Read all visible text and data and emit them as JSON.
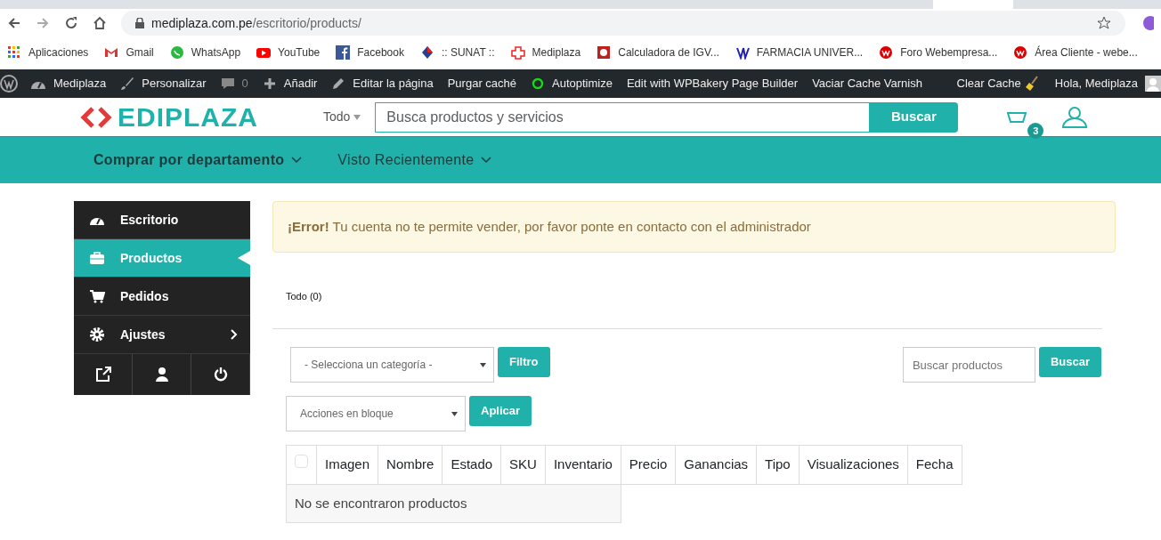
{
  "browser": {
    "address": {
      "domain": "mediplaza.com.pe",
      "path": "/escritorio/products/"
    },
    "bookmarks": [
      {
        "label": "Aplicaciones"
      },
      {
        "label": "Gmail"
      },
      {
        "label": "WhatsApp"
      },
      {
        "label": "YouTube"
      },
      {
        "label": "Facebook"
      },
      {
        "label": ":: SUNAT ::"
      },
      {
        "label": "Mediplaza"
      },
      {
        "label": "Calculadora de IGV..."
      },
      {
        "label": "FARMACIA UNIVER..."
      },
      {
        "label": "Foro Webempresa..."
      },
      {
        "label": "Área Cliente - webe..."
      }
    ]
  },
  "admin_bar": {
    "site": "Mediplaza",
    "items": [
      {
        "label": "Personalizar"
      },
      {
        "label": "0"
      },
      {
        "label": "Añadir"
      },
      {
        "label": "Editar la página"
      },
      {
        "label": "Purgar caché"
      },
      {
        "label": "Autoptimize"
      },
      {
        "label": "Edit with WPBakery Page Builder"
      },
      {
        "label": "Vaciar Cache Varnish"
      }
    ],
    "clear_cache": "Clear Cache",
    "greeting": "Hola, Mediplaza"
  },
  "header": {
    "logo": "EDIPLAZA",
    "category": "Todo",
    "search_placeholder": "Busca productos y servicios",
    "search_button": "Buscar",
    "cart_count": "3"
  },
  "nav": [
    {
      "label": "Comprar por departamento",
      "bold": true
    },
    {
      "label": "Visto Recientemente",
      "bold": false
    }
  ],
  "sidebar": {
    "items": [
      {
        "label": "Escritorio",
        "selected": false,
        "submenu": false
      },
      {
        "label": "Productos",
        "selected": true,
        "submenu": false
      },
      {
        "label": "Pedidos",
        "selected": false,
        "submenu": false
      },
      {
        "label": "Ajustes",
        "selected": false,
        "submenu": true
      }
    ]
  },
  "alert": {
    "message": "**¡Error!** Tu cuenta no te permite vender, por favor ponte en contacto con el administrador"
  },
  "filter_link": "Todo (0)",
  "category_select": "- Selecciona un categoría -",
  "filter_button": "Filtro",
  "product_search_placeholder": "Buscar productos",
  "product_search_button": "Buscar",
  "bulk_select": "Acciones en bloque",
  "apply_button": "Aplicar",
  "table": {
    "select_all": {
      "checked": false
    },
    "columns": [
      "Imagen",
      "Nombre",
      "Estado",
      "SKU",
      "Inventario",
      "Precio",
      "Ganancias",
      "Tipo",
      "Visualizaciones",
      "Fecha"
    ],
    "empty_message": "No se encontraron productos"
  }
}
